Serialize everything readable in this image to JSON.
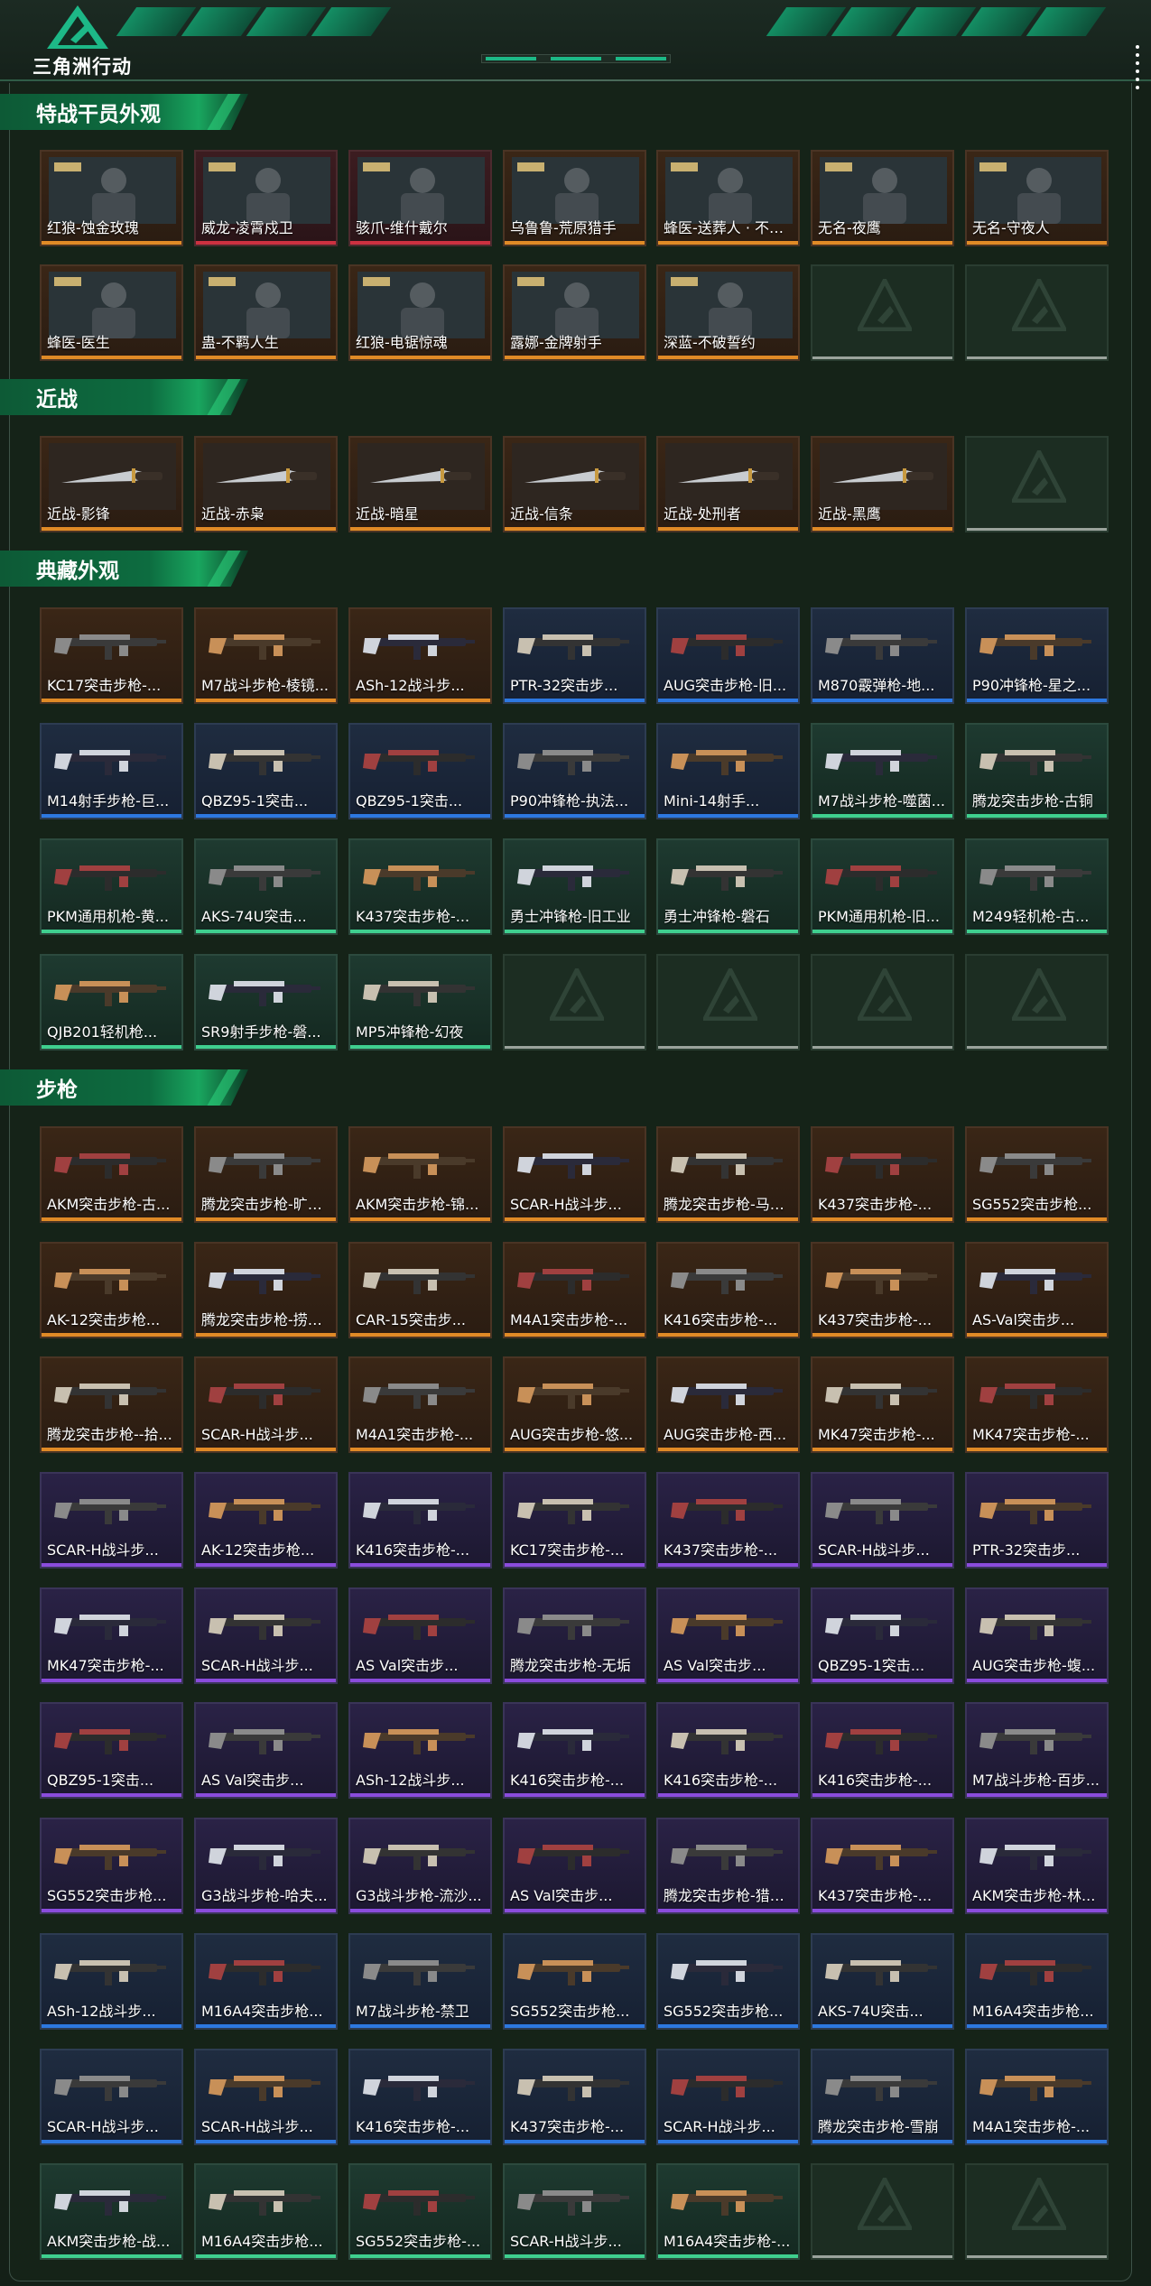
{
  "app": {
    "title": "三角洲行动",
    "logo_icon": "delta-triangle-logo-icon",
    "accent": "#1db887"
  },
  "sections": [
    {
      "title": "特战干员外观",
      "items": [
        {
          "label": "红狼-蚀金玫瑰",
          "rarity": "gold"
        },
        {
          "label": "威龙-凌霄戍卫",
          "rarity": "red"
        },
        {
          "label": "骇爪-维什戴尔",
          "rarity": "red"
        },
        {
          "label": "乌鲁鲁-荒原猎手",
          "rarity": "gold"
        },
        {
          "label": "蜂医-送葬人 · 不赎...",
          "rarity": "gold"
        },
        {
          "label": "无名-夜鹰",
          "rarity": "gold"
        },
        {
          "label": "无名-守夜人",
          "rarity": "gold"
        },
        {
          "label": "蜂医-医生",
          "rarity": "gold"
        },
        {
          "label": "蛊-不羁人生",
          "rarity": "gold"
        },
        {
          "label": "红狼-电锯惊魂",
          "rarity": "gold"
        },
        {
          "label": "露娜-金牌射手",
          "rarity": "gold"
        },
        {
          "label": "深蓝-不破誓约",
          "rarity": "gold"
        },
        {
          "label": "",
          "rarity": "empty"
        },
        {
          "label": "",
          "rarity": "empty"
        }
      ]
    },
    {
      "title": "近战",
      "items": [
        {
          "label": "近战-影锋",
          "rarity": "gold"
        },
        {
          "label": "近战-赤枭",
          "rarity": "gold"
        },
        {
          "label": "近战-暗星",
          "rarity": "gold"
        },
        {
          "label": "近战-信条",
          "rarity": "gold"
        },
        {
          "label": "近战-处刑者",
          "rarity": "gold"
        },
        {
          "label": "近战-黑鹰",
          "rarity": "gold"
        },
        {
          "label": "",
          "rarity": "empty"
        }
      ]
    },
    {
      "title": "典藏外观",
      "items": [
        {
          "label": "KC17突击步枪-...",
          "rarity": "gold"
        },
        {
          "label": "M7战斗步枪-棱镜...",
          "rarity": "gold"
        },
        {
          "label": "ASh-12战斗步...",
          "rarity": "gold"
        },
        {
          "label": "PTR-32突击步...",
          "rarity": "blue"
        },
        {
          "label": "AUG突击步枪-旧...",
          "rarity": "blue"
        },
        {
          "label": "M870霰弹枪-地...",
          "rarity": "blue"
        },
        {
          "label": "P90冲锋枪-星之...",
          "rarity": "blue"
        },
        {
          "label": "M14射手步枪-巨...",
          "rarity": "blue"
        },
        {
          "label": "QBZ95-1突击...",
          "rarity": "blue"
        },
        {
          "label": "QBZ95-1突击...",
          "rarity": "blue"
        },
        {
          "label": "P90冲锋枪-执法...",
          "rarity": "blue"
        },
        {
          "label": "Mini-14射手...",
          "rarity": "blue"
        },
        {
          "label": "M7战斗步枪-噬菌...",
          "rarity": "green"
        },
        {
          "label": "腾龙突击步枪-古铜",
          "rarity": "green"
        },
        {
          "label": "PKM通用机枪-黄...",
          "rarity": "green"
        },
        {
          "label": "AKS-74U突击...",
          "rarity": "green"
        },
        {
          "label": "K437突击步枪-...",
          "rarity": "green"
        },
        {
          "label": "勇士冲锋枪-旧工业",
          "rarity": "green"
        },
        {
          "label": "勇士冲锋枪-磐石",
          "rarity": "green"
        },
        {
          "label": "PKM通用机枪-旧...",
          "rarity": "green"
        },
        {
          "label": "M249轻机枪-古...",
          "rarity": "green"
        },
        {
          "label": "QJB201轻机枪...",
          "rarity": "green"
        },
        {
          "label": "SR9射手步枪-磐...",
          "rarity": "green"
        },
        {
          "label": "MP5冲锋枪-幻夜",
          "rarity": "green"
        },
        {
          "label": "",
          "rarity": "empty"
        },
        {
          "label": "",
          "rarity": "empty"
        },
        {
          "label": "",
          "rarity": "empty"
        },
        {
          "label": "",
          "rarity": "empty"
        }
      ]
    },
    {
      "title": "步枪",
      "items": [
        {
          "label": "AKM突击步枪-古...",
          "rarity": "gold"
        },
        {
          "label": "腾龙突击步枪-旷野...",
          "rarity": "gold"
        },
        {
          "label": "AKM突击步枪-锦...",
          "rarity": "gold"
        },
        {
          "label": "SCAR-H战斗步...",
          "rarity": "gold"
        },
        {
          "label": "腾龙突击步枪-马年...",
          "rarity": "gold"
        },
        {
          "label": "K437突击步枪-...",
          "rarity": "gold"
        },
        {
          "label": "SG552突击步枪...",
          "rarity": "gold"
        },
        {
          "label": "AK-12突击步枪...",
          "rarity": "gold"
        },
        {
          "label": "腾龙突击步枪-捞点...",
          "rarity": "gold"
        },
        {
          "label": "CAR-15突击步...",
          "rarity": "gold"
        },
        {
          "label": "M4A1突击步枪-...",
          "rarity": "gold"
        },
        {
          "label": "K416突击步枪-...",
          "rarity": "gold"
        },
        {
          "label": "K437突击步枪-...",
          "rarity": "gold"
        },
        {
          "label": "AS-Val突击步...",
          "rarity": "gold"
        },
        {
          "label": "腾龙突击步枪--拾...",
          "rarity": "gold"
        },
        {
          "label": "SCAR-H战斗步...",
          "rarity": "gold"
        },
        {
          "label": "M4A1突击步枪-...",
          "rarity": "gold"
        },
        {
          "label": "AUG突击步枪-悠...",
          "rarity": "gold"
        },
        {
          "label": "AUG突击步枪-西...",
          "rarity": "gold"
        },
        {
          "label": "MK47突击步枪-...",
          "rarity": "gold"
        },
        {
          "label": "MK47突击步枪-...",
          "rarity": "gold"
        },
        {
          "label": "SCAR-H战斗步...",
          "rarity": "purple"
        },
        {
          "label": "AK-12突击步枪...",
          "rarity": "purple"
        },
        {
          "label": "K416突击步枪-...",
          "rarity": "purple"
        },
        {
          "label": "KC17突击步枪-...",
          "rarity": "purple"
        },
        {
          "label": "K437突击步枪-...",
          "rarity": "purple"
        },
        {
          "label": "SCAR-H战斗步...",
          "rarity": "purple"
        },
        {
          "label": "PTR-32突击步...",
          "rarity": "purple"
        },
        {
          "label": "MK47突击步枪-...",
          "rarity": "purple"
        },
        {
          "label": "SCAR-H战斗步...",
          "rarity": "purple"
        },
        {
          "label": "AS Val突击步...",
          "rarity": "purple"
        },
        {
          "label": "腾龙突击步枪-无垢",
          "rarity": "purple"
        },
        {
          "label": "AS Val突击步...",
          "rarity": "purple"
        },
        {
          "label": "QBZ95-1突击...",
          "rarity": "purple"
        },
        {
          "label": "AUG突击步枪-蝮...",
          "rarity": "purple"
        },
        {
          "label": "QBZ95-1突击...",
          "rarity": "purple"
        },
        {
          "label": "AS Val突击步...",
          "rarity": "purple"
        },
        {
          "label": "ASh-12战斗步...",
          "rarity": "purple"
        },
        {
          "label": "K416突击步枪-...",
          "rarity": "purple"
        },
        {
          "label": "K416突击步枪-...",
          "rarity": "purple"
        },
        {
          "label": "K416突击步枪-...",
          "rarity": "purple"
        },
        {
          "label": "M7战斗步枪-百步...",
          "rarity": "purple"
        },
        {
          "label": "SG552突击步枪...",
          "rarity": "purple"
        },
        {
          "label": "G3战斗步枪-哈夫...",
          "rarity": "purple"
        },
        {
          "label": "G3战斗步枪-流沙...",
          "rarity": "purple"
        },
        {
          "label": "AS Val突击步...",
          "rarity": "purple"
        },
        {
          "label": "腾龙突击步枪-猎鳄...",
          "rarity": "purple"
        },
        {
          "label": "K437突击步枪-...",
          "rarity": "purple"
        },
        {
          "label": "AKM突击步枪-林...",
          "rarity": "purple"
        },
        {
          "label": "ASh-12战斗步...",
          "rarity": "blue"
        },
        {
          "label": "M16A4突击步枪...",
          "rarity": "blue"
        },
        {
          "label": "M7战斗步枪-禁卫",
          "rarity": "blue"
        },
        {
          "label": "SG552突击步枪...",
          "rarity": "blue"
        },
        {
          "label": "SG552突击步枪...",
          "rarity": "blue"
        },
        {
          "label": "AKS-74U突击...",
          "rarity": "blue"
        },
        {
          "label": "M16A4突击步枪...",
          "rarity": "blue"
        },
        {
          "label": "SCAR-H战斗步...",
          "rarity": "blue"
        },
        {
          "label": "SCAR-H战斗步...",
          "rarity": "blue"
        },
        {
          "label": "K416突击步枪-...",
          "rarity": "blue"
        },
        {
          "label": "K437突击步枪-...",
          "rarity": "blue"
        },
        {
          "label": "SCAR-H战斗步...",
          "rarity": "blue"
        },
        {
          "label": "腾龙突击步枪-雪崩",
          "rarity": "blue"
        },
        {
          "label": "M4A1突击步枪-...",
          "rarity": "blue"
        },
        {
          "label": "AKM突击步枪-战...",
          "rarity": "green"
        },
        {
          "label": "M16A4突击步枪...",
          "rarity": "green"
        },
        {
          "label": "SG552突击步枪-...",
          "rarity": "green"
        },
        {
          "label": "SCAR-H战斗步...",
          "rarity": "green"
        },
        {
          "label": "M16A4突击步枪-...",
          "rarity": "green"
        },
        {
          "label": "",
          "rarity": "empty"
        },
        {
          "label": "",
          "rarity": "empty"
        }
      ]
    }
  ]
}
